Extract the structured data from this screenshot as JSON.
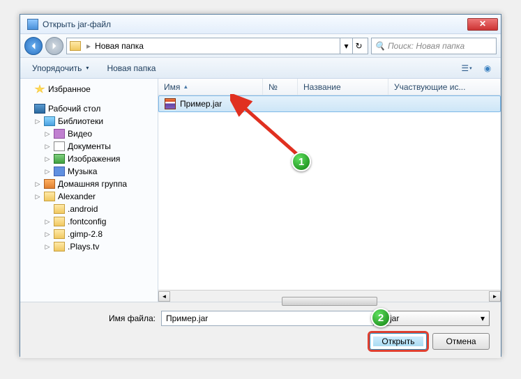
{
  "window": {
    "title": "Открыть jar-файл"
  },
  "nav": {
    "breadcrumb": "Новая папка",
    "search_placeholder": "Поиск: Новая папка"
  },
  "toolbar": {
    "organize": "Упорядочить",
    "new_folder": "Новая папка"
  },
  "tree": {
    "favorites": "Избранное",
    "desktop": "Рабочий стол",
    "libraries": "Библиотеки",
    "videos": "Видео",
    "documents": "Документы",
    "pictures": "Изображения",
    "music": "Музыка",
    "homegroup": "Домашняя группа",
    "user": "Alexander",
    "f_android": ".android",
    "f_fontconfig": ".fontconfig",
    "f_gimp": ".gimp-2.8",
    "f_plays": ".Plays.tv"
  },
  "columns": {
    "name": "Имя",
    "num": "№",
    "title_col": "Название",
    "artists": "Участвующие ис..."
  },
  "files": {
    "item0": "Пример.jar"
  },
  "footer": {
    "filename_label": "Имя файла:",
    "filename_value": "Пример.jar",
    "filter": "*.jar",
    "open": "Открыть",
    "cancel": "Отмена"
  },
  "callouts": {
    "c1": "1",
    "c2": "2"
  }
}
